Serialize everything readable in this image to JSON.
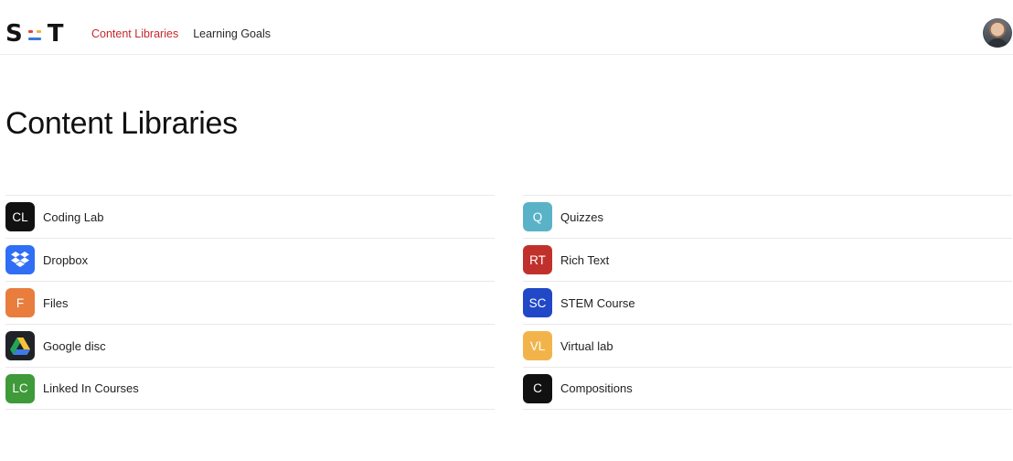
{
  "header": {
    "logo_text_left": "S",
    "logo_text_right": "T",
    "logo_bar_colors": [
      "#e0483a",
      "#f3b43a",
      "#3a79d8",
      "#39a85a"
    ],
    "nav": [
      {
        "label": "Content Libraries",
        "active": true
      },
      {
        "label": "Learning Goals",
        "active": false
      }
    ],
    "colors": {
      "active_nav": "#c7282e"
    }
  },
  "page": {
    "title": "Content Libraries"
  },
  "libraries_left": [
    {
      "label": "Coding Lab",
      "badge": "CL",
      "color": "#111111",
      "icon": "cl-badge"
    },
    {
      "label": "Dropbox",
      "badge": "",
      "color": "#2f6ef5",
      "icon": "dropbox-icon"
    },
    {
      "label": "Files",
      "badge": "F",
      "color": "#e87d3e",
      "icon": "f-badge"
    },
    {
      "label": "Google disc",
      "badge": "",
      "color": "#1f2226",
      "icon": "google-drive-icon"
    },
    {
      "label": "Linked In Courses",
      "badge": "LC",
      "color": "#3f9a3a",
      "icon": "lc-badge"
    }
  ],
  "libraries_right": [
    {
      "label": "Quizzes",
      "badge": "Q",
      "color": "#5ab2c7",
      "icon": "q-badge"
    },
    {
      "label": "Rich Text",
      "badge": "RT",
      "color": "#c1312c",
      "icon": "rt-badge"
    },
    {
      "label": "STEM Course",
      "badge": "SC",
      "color": "#2048c7",
      "icon": "sc-badge"
    },
    {
      "label": "Virtual lab",
      "badge": "VL",
      "color": "#f2b44a",
      "icon": "vl-badge"
    },
    {
      "label": "Compositions",
      "badge": "C",
      "color": "#111111",
      "icon": "c-badge"
    }
  ]
}
